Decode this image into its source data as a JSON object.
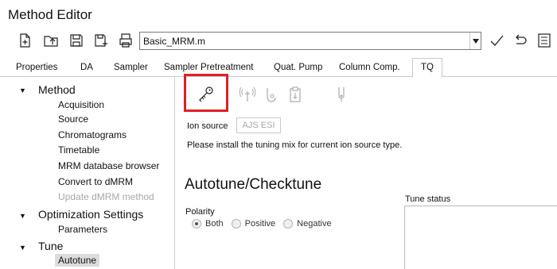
{
  "window": {
    "title": "Method Editor"
  },
  "toolbar": {
    "icons": [
      "new-file-icon",
      "open-folder-icon",
      "save-icon",
      "save-as-icon",
      "print-icon"
    ],
    "method_name": "Basic_MRM.m",
    "right_icons": [
      "checkmark-icon",
      "undo-icon",
      "list-icon"
    ]
  },
  "tabs": [
    {
      "label": "Properties",
      "active": false
    },
    {
      "label": "DA",
      "active": false
    },
    {
      "label": "Sampler",
      "active": false
    },
    {
      "label": "Sampler Pretreatment",
      "active": false
    },
    {
      "label": "Quat. Pump",
      "active": false
    },
    {
      "label": "Column Comp.",
      "active": false
    },
    {
      "label": "TQ",
      "active": true
    }
  ],
  "tree": {
    "method": {
      "label": "Method",
      "children": [
        "Acquisition",
        "Source",
        "Chromatograms",
        "Timetable",
        "MRM database browser",
        "Convert to dMRM",
        "Update dMRM method"
      ]
    },
    "optimization": {
      "label": "Optimization Settings",
      "children": [
        "Parameters"
      ]
    },
    "tune": {
      "label": "Tune",
      "children": [
        "Autotune"
      ]
    }
  },
  "content": {
    "icons": [
      "key-icon",
      "spray-icon",
      "tune-mix-icon",
      "clipboard-icon",
      "vial-icon"
    ],
    "ion_source_label": "Ion source",
    "ion_source_value": "AJS ESI",
    "install_message": "Please install the tuning mix for current ion source type.",
    "section_title": "Autotune/Checktune",
    "tune_status_label": "Tune status",
    "polarity": {
      "label": "Polarity",
      "options": [
        "Both",
        "Positive",
        "Negative"
      ],
      "selected": "Both"
    }
  },
  "colors": {
    "highlight": "#e21f26",
    "disabled": "#a8a8a8"
  }
}
